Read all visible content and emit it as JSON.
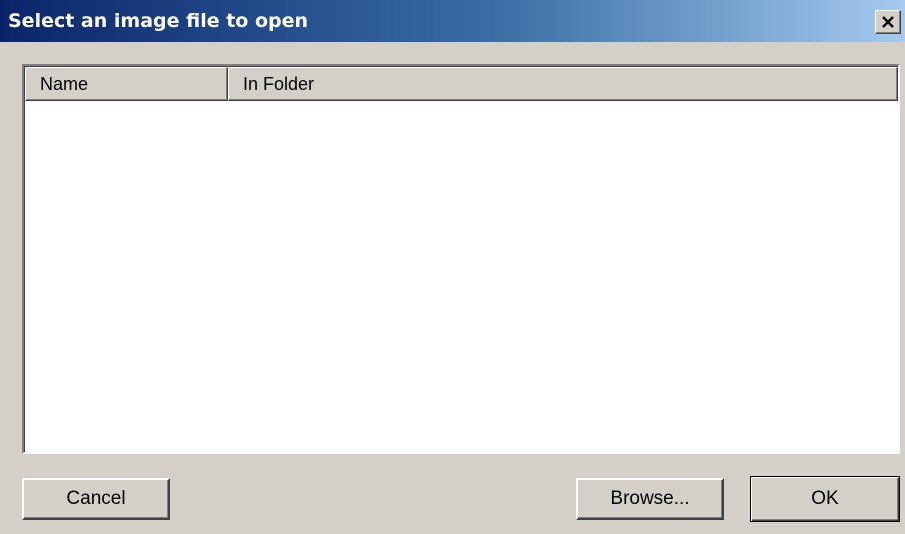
{
  "window": {
    "title": "Select an image file to open"
  },
  "titlebar": {
    "close_icon": "close-x-icon"
  },
  "list": {
    "columns": [
      "Name",
      "In Folder"
    ],
    "rows": []
  },
  "buttons": {
    "cancel_label": "Cancel",
    "browse_label": "Browse...",
    "ok_label": "OK"
  },
  "colors": {
    "title_gradient_start": "#0a246a",
    "title_gradient_end": "#a6caf0",
    "face": "#d4d0c8"
  }
}
